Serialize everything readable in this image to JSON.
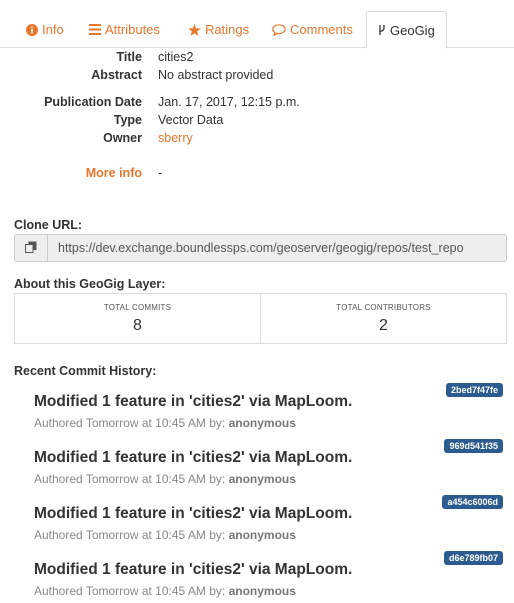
{
  "tabs": [
    {
      "label": "Info",
      "icon": "info-circle-icon"
    },
    {
      "label": "Attributes",
      "icon": "list-icon"
    },
    {
      "label": "Ratings",
      "icon": "star-icon"
    },
    {
      "label": "Comments",
      "icon": "comment-icon"
    },
    {
      "label": "GeoGig",
      "icon": "branch-icon",
      "active": true
    }
  ],
  "details": {
    "title_label": "Title",
    "title_value": "cities2",
    "abstract_label": "Abstract",
    "abstract_value": "No abstract provided",
    "pubdate_label": "Publication Date",
    "pubdate_value": "Jan. 17, 2017, 12:15 p.m.",
    "type_label": "Type",
    "type_value": "Vector Data",
    "owner_label": "Owner",
    "owner_value": "sberry",
    "more_label": "More info",
    "more_value": "-"
  },
  "clone": {
    "title": "Clone URL:",
    "url": "https://dev.exchange.boundlessps.com/geoserver/geogig/repos/test_repo"
  },
  "about": {
    "title": "About this GeoGig Layer:",
    "commits_label": "TOTAL COMMITS",
    "commits_value": "8",
    "contributors_label": "TOTAL CONTRIBUTORS",
    "contributors_value": "2"
  },
  "history": {
    "title": "Recent Commit History:",
    "commits": [
      {
        "hash": "2bed7f47fe",
        "message": "Modified 1 feature in 'cities2' via MapLoom.",
        "authored": "Authored Tomorrow at 10:45 AM by:",
        "author": "anonymous"
      },
      {
        "hash": "969d541f35",
        "message": "Modified 1 feature in 'cities2' via MapLoom.",
        "authored": "Authored Tomorrow at 10:45 AM by:",
        "author": "anonymous"
      },
      {
        "hash": "a454c6006d",
        "message": "Modified 1 feature in 'cities2' via MapLoom.",
        "authored": "Authored Tomorrow at 10:45 AM by:",
        "author": "anonymous"
      },
      {
        "hash": "d6e789fb07",
        "message": "Modified 1 feature in 'cities2' via MapLoom.",
        "authored": "Authored Tomorrow at 10:45 AM by:",
        "author": "anonymous"
      }
    ]
  },
  "colors": {
    "accent": "#e8772e",
    "hash_badge": "#2c5c8f"
  }
}
